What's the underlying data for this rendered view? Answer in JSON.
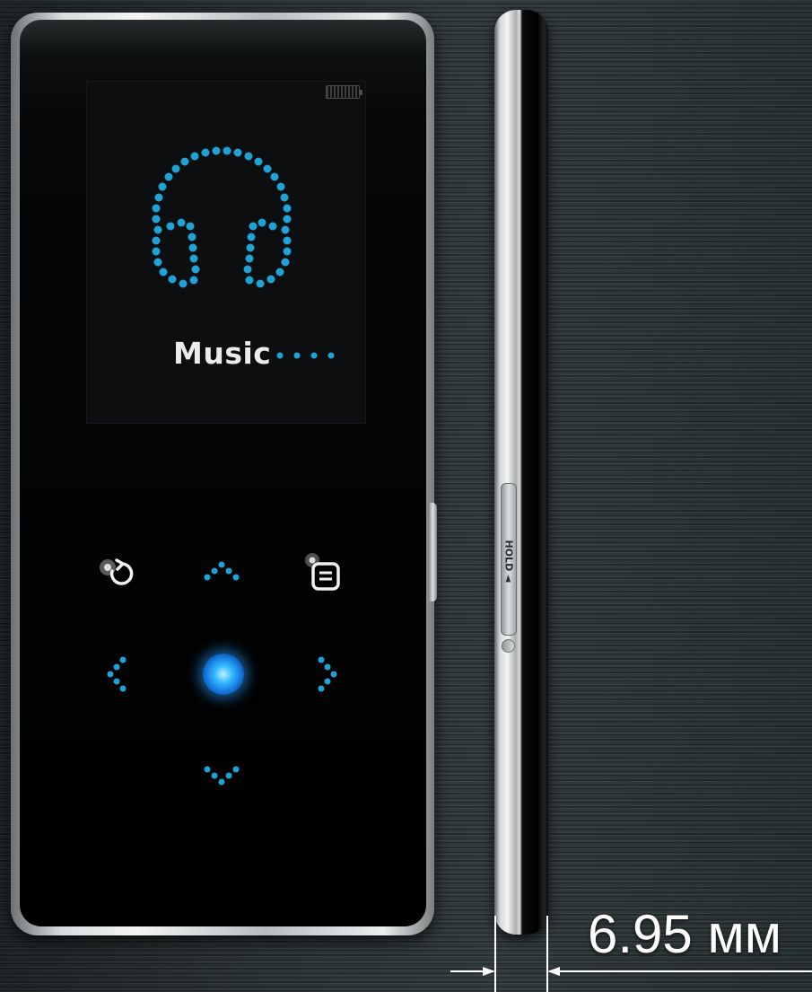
{
  "screen": {
    "menu_label": "Music"
  },
  "side": {
    "hold_label": "HOLD ◄"
  },
  "dimension": {
    "thickness": "6.95 мм"
  },
  "icons": {
    "battery": "battery-icon",
    "headphones": "headphones-icon",
    "back": "back-icon",
    "menu": "menu-icon",
    "up": "chevron-up-icon",
    "down": "chevron-down-icon",
    "left": "chevron-left-icon",
    "right": "chevron-right-icon",
    "select": "select-button",
    "power": "power-icon"
  },
  "colors": {
    "accent": "#1fa2d6",
    "label": "#ececec",
    "select_glow": "#35b8ff"
  }
}
